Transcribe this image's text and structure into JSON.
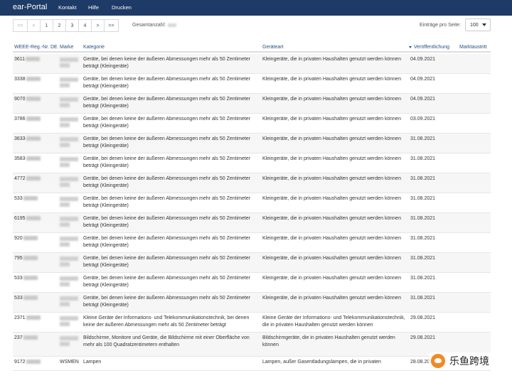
{
  "nav": {
    "brand": "ear-Portal",
    "links": [
      "Kontakt",
      "Hilfe",
      "Drucken"
    ]
  },
  "pager": {
    "buttons": [
      "<<",
      "<",
      "1",
      "2",
      "3",
      "4",
      ">",
      ">>"
    ],
    "total_label": "Gesamtanzahl:",
    "per_page_label": "Einträge pro Seite:",
    "per_page_value": "100"
  },
  "table": {
    "headers": {
      "reg": "WEEE-Reg.-Nr. DE",
      "brand": "Marke",
      "category": "Kategorie",
      "type": "Geräteart",
      "published": "Veröffentlichung",
      "exit": "Marktaustritt"
    },
    "rows": [
      {
        "reg": "3611",
        "category": "Geräte, bei denen keine der äußeren Abmessungen mehr als 50 Zentimeter beträgt (Kleingeräte)",
        "type": "Kleingeräte, die in privaten Haushalten genutzt werden können",
        "date": "04.09.2021"
      },
      {
        "reg": "3338",
        "category": "Geräte, bei denen keine der äußeren Abmessungen mehr als 50 Zentimeter beträgt (Kleingeräte)",
        "type": "Kleingeräte, die in privaten Haushalten genutzt werden können",
        "date": "04.09.2021"
      },
      {
        "reg": "9070",
        "category": "Geräte, bei denen keine der äußeren Abmessungen mehr als 50 Zentimeter beträgt (Kleingeräte)",
        "type": "Kleingeräte, die in privaten Haushalten genutzt werden können",
        "date": "04.09.2021"
      },
      {
        "reg": "3786",
        "category": "Geräte, bei denen keine der äußeren Abmessungen mehr als 50 Zentimeter beträgt (Kleingeräte)",
        "type": "Kleingeräte, die in privaten Haushalten genutzt werden können",
        "date": "03.09.2021"
      },
      {
        "reg": "3633",
        "category": "Geräte, bei denen keine der äußeren Abmessungen mehr als 50 Zentimeter beträgt (Kleingeräte)",
        "type": "Kleingeräte, die in privaten Haushalten genutzt werden können",
        "date": "31.08.2021"
      },
      {
        "reg": "3583",
        "category": "Geräte, bei denen keine der äußeren Abmessungen mehr als 50 Zentimeter beträgt (Kleingeräte)",
        "type": "Kleingeräte, die in privaten Haushalten genutzt werden können",
        "date": "31.08.2021"
      },
      {
        "reg": "4772",
        "category": "Geräte, bei denen keine der äußeren Abmessungen mehr als 50 Zentimeter beträgt (Kleingeräte)",
        "type": "Kleingeräte, die in privaten Haushalten genutzt werden können",
        "date": "31.08.2021"
      },
      {
        "reg": "533",
        "category": "Geräte, bei denen keine der äußeren Abmessungen mehr als 50 Zentimeter beträgt (Kleingeräte)",
        "type": "Kleingeräte, die in privaten Haushalten genutzt werden können",
        "date": "31.08.2021"
      },
      {
        "reg": "6195",
        "category": "Geräte, bei denen keine der äußeren Abmessungen mehr als 50 Zentimeter beträgt (Kleingeräte)",
        "type": "Kleingeräte, die in privaten Haushalten genutzt werden können",
        "date": "31.08.2021"
      },
      {
        "reg": "920",
        "category": "Geräte, bei denen keine der äußeren Abmessungen mehr als 50 Zentimeter beträgt (Kleingeräte)",
        "type": "Kleingeräte, die in privaten Haushalten genutzt werden können",
        "date": "31.08.2021"
      },
      {
        "reg": "795",
        "category": "Geräte, bei denen keine der äußeren Abmessungen mehr als 50 Zentimeter beträgt (Kleingeräte)",
        "type": "Kleingeräte, die in privaten Haushalten genutzt werden können",
        "date": "31.08.2021"
      },
      {
        "reg": "533",
        "category": "Geräte, bei denen keine der äußeren Abmessungen mehr als 50 Zentimeter beträgt (Kleingeräte)",
        "type": "Kleingeräte, die in privaten Haushalten genutzt werden können",
        "date": "31.08.2021"
      },
      {
        "reg": "533",
        "category": "Geräte, bei denen keine der äußeren Abmessungen mehr als 50 Zentimeter beträgt (Kleingeräte)",
        "type": "Kleingeräte, die in privaten Haushalten genutzt werden können",
        "date": "31.08.2021"
      },
      {
        "reg": "2371",
        "category": "Kleine Geräte der Informations- und Telekommunikationstechnik, bei denen keine der äußeren Abmessungen mehr als 50 Zentimeter beträgt",
        "type": "Kleine Geräte der Informations- und Telekommunikationstechnik, die in privaten Haushalten genutzt werden können",
        "date": "29.08.2021"
      },
      {
        "reg": "237",
        "category": "Bildschirme, Monitore und Geräte, die Bildschirme mit einer Oberfläche von mehr als 100 Quadratzentimetern enthalten",
        "type": "Bildschirmgeräte, die in privaten Haushalten genutzt werden können",
        "date": "29.08.2021"
      },
      {
        "reg": "9172",
        "brand": "WSMEN",
        "category": "Lampen",
        "type": "Lampen, außer Gasentladungslampen, die in privaten",
        "date": "28.08.2021"
      }
    ]
  },
  "watermark": {
    "text": "乐鱼跨境",
    "logo_color": "#f08a24"
  },
  "colors": {
    "navbar": "#1e3a66",
    "link": "#2a5080"
  }
}
